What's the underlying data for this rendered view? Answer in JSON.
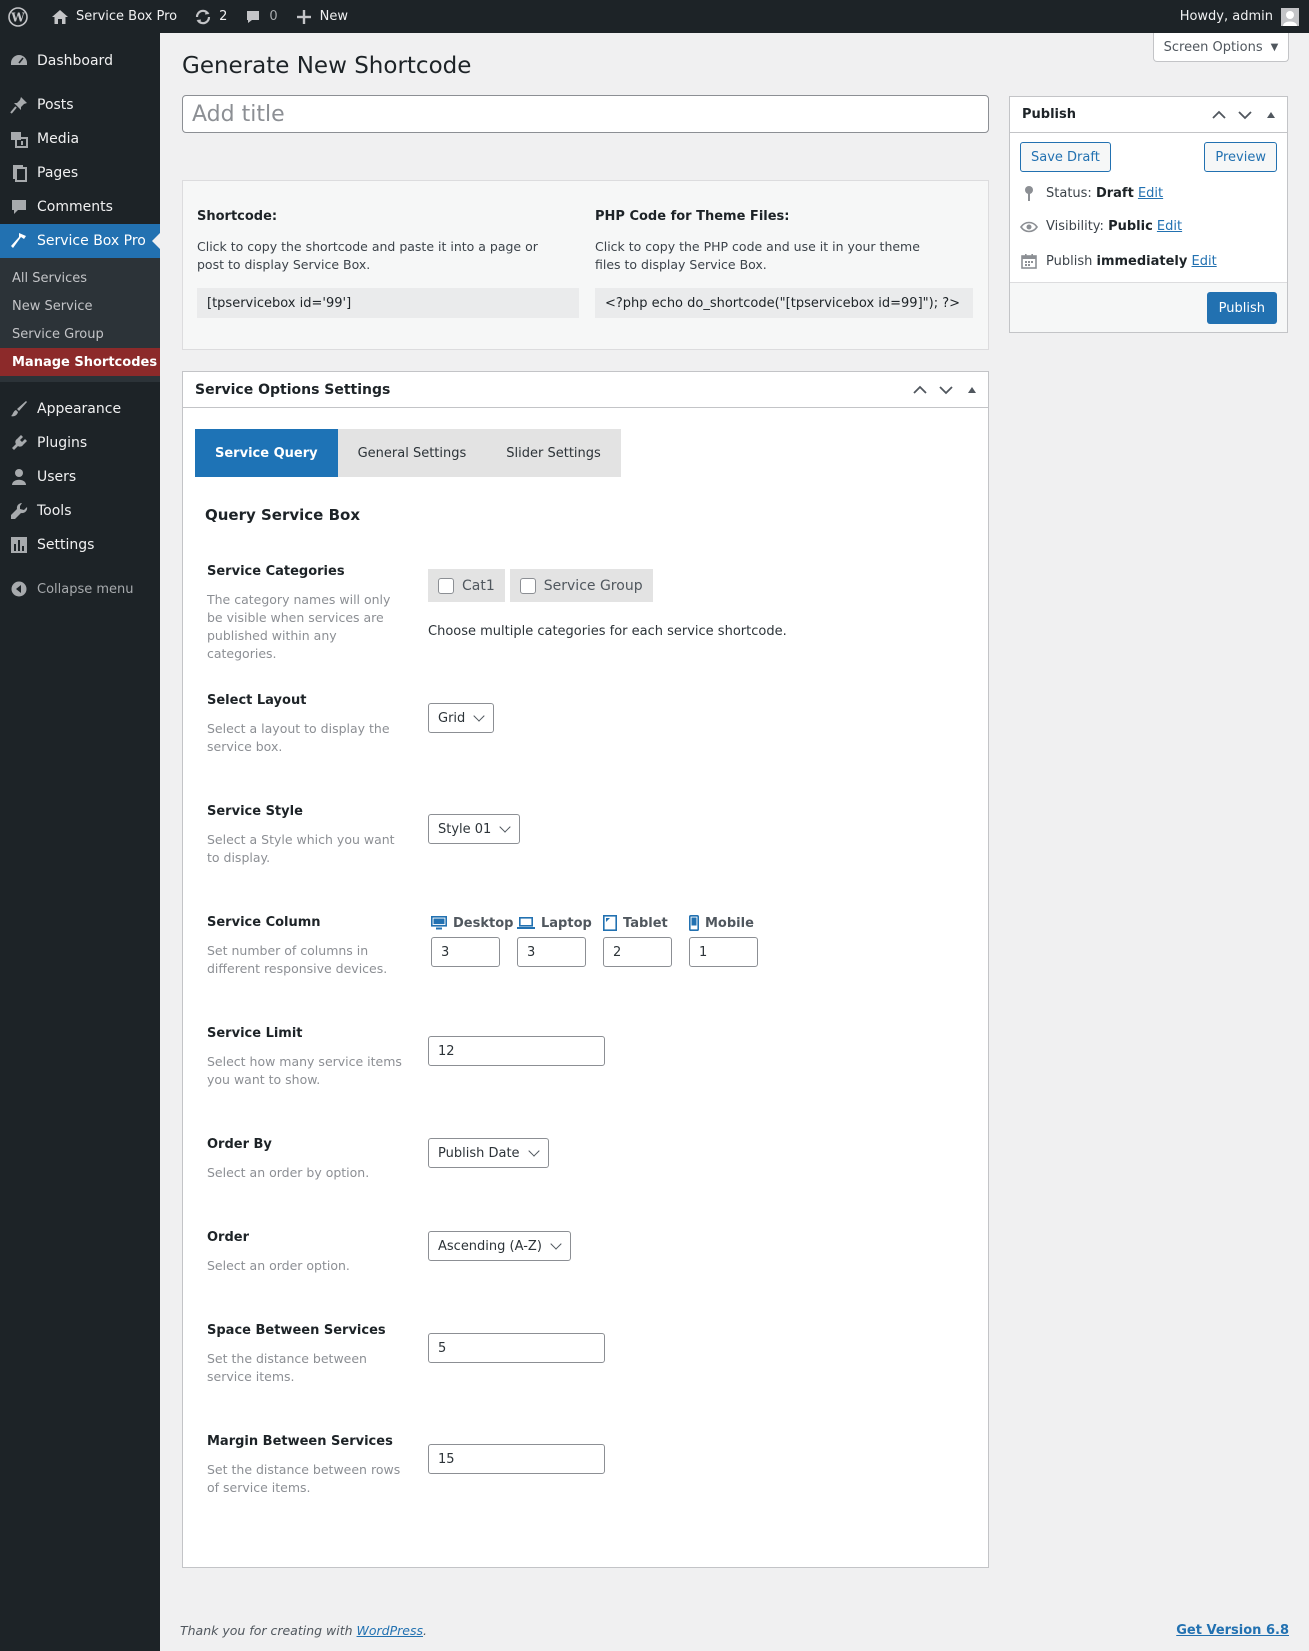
{
  "adminbar": {
    "site_name": "Service Box Pro",
    "updates_count": "2",
    "comments_count": "0",
    "new_label": "New",
    "howdy": "Howdy, admin"
  },
  "sidebar": {
    "items": [
      {
        "label": "Dashboard",
        "icon": "dashboard-icon"
      },
      {
        "label": "Posts",
        "icon": "pin-icon"
      },
      {
        "label": "Media",
        "icon": "media-icon"
      },
      {
        "label": "Pages",
        "icon": "pages-icon"
      },
      {
        "label": "Comments",
        "icon": "comments-icon"
      },
      {
        "label": "Service Box Pro",
        "icon": "hammer-icon"
      }
    ],
    "submenu": [
      "All Services",
      "New Service",
      "Service Group",
      "Manage Shortcodes"
    ],
    "items2": [
      {
        "label": "Appearance",
        "icon": "brush-icon"
      },
      {
        "label": "Plugins",
        "icon": "plugin-icon"
      },
      {
        "label": "Users",
        "icon": "users-icon"
      },
      {
        "label": "Tools",
        "icon": "wrench-icon"
      },
      {
        "label": "Settings",
        "icon": "settings-icon"
      }
    ],
    "collapse": "Collapse menu"
  },
  "screen_options": "Screen Options",
  "page_title": "Generate New Shortcode",
  "title_placeholder": "Add title",
  "shortcode": {
    "label": "Shortcode:",
    "desc": "Click to copy the shortcode and paste it into a page or post to display Service Box.",
    "code": "[tpservicebox id='99']",
    "php_label": "PHP Code for Theme Files:",
    "php_desc": "Click to copy the PHP code and use it in your theme files to display Service Box.",
    "php_code": "<?php echo do_shortcode(\"[tpservicebox id=99]\"); ?>"
  },
  "settings": {
    "title": "Service Options Settings",
    "tabs": [
      "Service Query",
      "General Settings",
      "Slider Settings"
    ],
    "heading": "Query Service Box",
    "categories": {
      "label": "Service Categories",
      "desc": "The category names will only be visible when services are published within any categories.",
      "options": [
        "Cat1",
        "Service Group"
      ],
      "hint": "Choose multiple categories for each service shortcode."
    },
    "layout": {
      "label": "Select Layout",
      "desc": "Select a layout to display the service box.",
      "value": "Grid"
    },
    "style": {
      "label": "Service Style",
      "desc": "Select a Style which you want to display.",
      "value": "Style 01"
    },
    "column": {
      "label": "Service Column",
      "desc": "Set number of columns in different responsive devices.",
      "devices": [
        {
          "label": "Desktop",
          "value": "3"
        },
        {
          "label": "Laptop",
          "value": "3"
        },
        {
          "label": "Tablet",
          "value": "2"
        },
        {
          "label": "Mobile",
          "value": "1"
        }
      ]
    },
    "limit": {
      "label": "Service Limit",
      "desc": "Select how many service items you want to show.",
      "value": "12"
    },
    "orderby": {
      "label": "Order By",
      "desc": "Select an order by option.",
      "value": "Publish Date"
    },
    "order": {
      "label": "Order",
      "desc": "Select an order option.",
      "value": "Ascending (A-Z)"
    },
    "space": {
      "label": "Space Between Services",
      "desc": "Set the distance between service items.",
      "value": "5"
    },
    "margin": {
      "label": "Margin Between Services",
      "desc": "Set the distance between rows of service items.",
      "value": "15"
    }
  },
  "publish": {
    "title": "Publish",
    "save_draft": "Save Draft",
    "preview": "Preview",
    "status_label": "Status:",
    "status_value": "Draft",
    "visibility_label": "Visibility:",
    "visibility_value": "Public",
    "publish_label": "Publish",
    "publish_value": "immediately",
    "edit": "Edit",
    "publish_button": "Publish"
  },
  "footer": {
    "thanks": "Thank you for creating with",
    "wp_link": "WordPress",
    "version": "Get Version 6.8"
  },
  "colors": {
    "accent": "#2271b1",
    "sidebar": "#1d2327",
    "current_sub": "#8c2a2a"
  }
}
